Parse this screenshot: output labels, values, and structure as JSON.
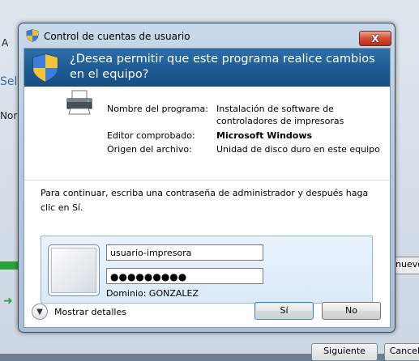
{
  "background": {
    "frag_a": "A",
    "frag_sele": "Sele",
    "frag_nor": "Nor",
    "frag_nuevo": "nuevo",
    "siguiente_label": "Siguiente",
    "cancelar_label": "Cancelar"
  },
  "dialog": {
    "title": "Control de cuentas de usuario",
    "close_label": "X",
    "question": "¿Desea permitir que este programa realice cambios en el equipo?",
    "program": {
      "name_label": "Nombre del programa:",
      "name_value_line1": "Instalación de software de",
      "name_value_line2": "controladores de impresoras",
      "publisher_label": "Editor comprobado:",
      "publisher_value": "Microsoft Windows",
      "origin_label": "Origen del archivo:",
      "origin_value": "Unidad de disco duro en este equipo"
    },
    "prompt": "Para continuar, escriba una contraseña de administrador y después haga clic en Sí.",
    "credentials": {
      "username": "usuario-impresora",
      "password_mask": "●●●●●●●●●",
      "domain": "Dominio: GONZALEZ"
    },
    "details_label": "Mostrar detalles",
    "yes_label": "Sí",
    "no_label": "No"
  },
  "colors": {
    "header_blue": "#1c5a93",
    "close_red": "#d5543c"
  },
  "icons": [
    "uac-shield-icon",
    "printer-icon",
    "chevron-down-icon",
    "user-tile-icon"
  ]
}
